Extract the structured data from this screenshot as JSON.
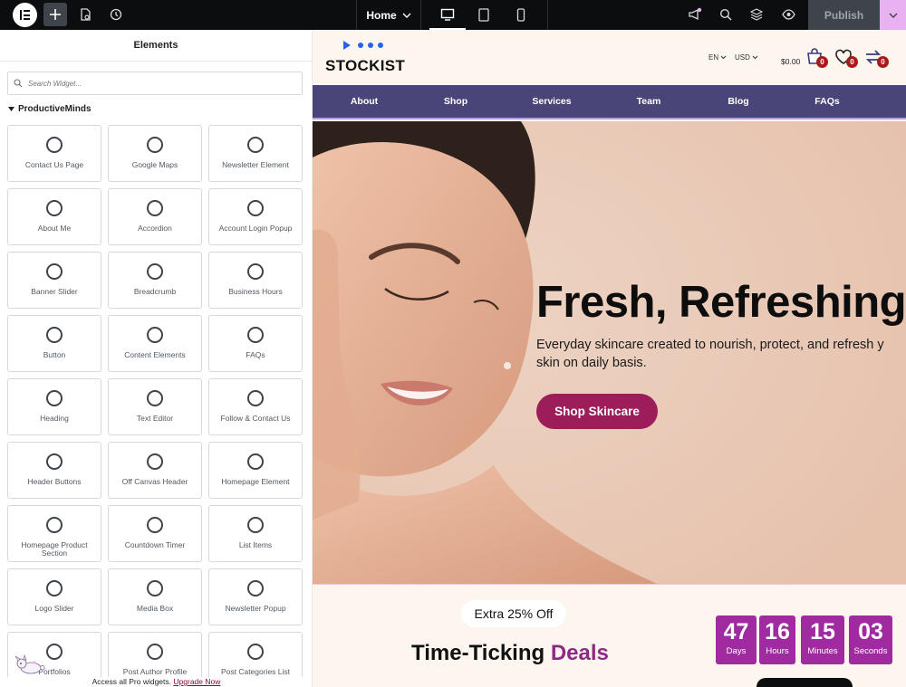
{
  "topbar": {
    "page_label": "Home",
    "publish_label": "Publish"
  },
  "panel": {
    "title": "Elements",
    "search_placeholder": "Search Widget...",
    "category": "ProductiveMinds",
    "widgets": [
      "Contact Us Page",
      "Google Maps",
      "Newsletter Element",
      "About Me",
      "Accordion",
      "Account Login Popup",
      "Banner Slider",
      "Breadcrumb",
      "Business Hours",
      "Button",
      "Content Elements",
      "FAQs",
      "Heading",
      "Text Editor",
      "Follow & Contact Us",
      "Header Buttons",
      "Off Canvas Header",
      "Homepage Element",
      "Homepage Product Section",
      "Countdown Timer",
      "List Items",
      "Logo Slider",
      "Media Box",
      "Newsletter Popup",
      "Portfolios",
      "Post Author Profile",
      "Post Categories List"
    ],
    "upgrade_text": "Access all Pro widgets.",
    "upgrade_link": "Upgrade Now"
  },
  "site": {
    "brand": "STOCKIST",
    "lang": "EN",
    "currency": "USD",
    "cart_amount": "$0.00",
    "cart_count": "0",
    "wishlist_count": "0",
    "compare_count": "0",
    "nav": [
      "About",
      "Shop",
      "Services",
      "Team",
      "Blog",
      "FAQs"
    ],
    "hero": {
      "title": "Fresh, Refreshing",
      "subtitle_line1": "Everyday skincare created to nourish, protect, and refresh y",
      "subtitle_line2": "skin on daily basis.",
      "button": "Shop Skincare"
    },
    "deals": {
      "pill": "Extra 25% Off",
      "title_a": "Time-Ticking",
      "title_b": "Deals",
      "countdown": [
        {
          "value": "47",
          "unit": "Days"
        },
        {
          "value": "16",
          "unit": "Hours"
        },
        {
          "value": "15",
          "unit": "Minutes"
        },
        {
          "value": "03",
          "unit": "Seconds"
        }
      ]
    }
  },
  "colors": {
    "nav_bg": "#4a4578",
    "hero_bg": "#eac9b5",
    "accent": "#9d1c5a",
    "countdown_bg": "#a02aa0",
    "publish_accent": "#e8b1f0"
  }
}
